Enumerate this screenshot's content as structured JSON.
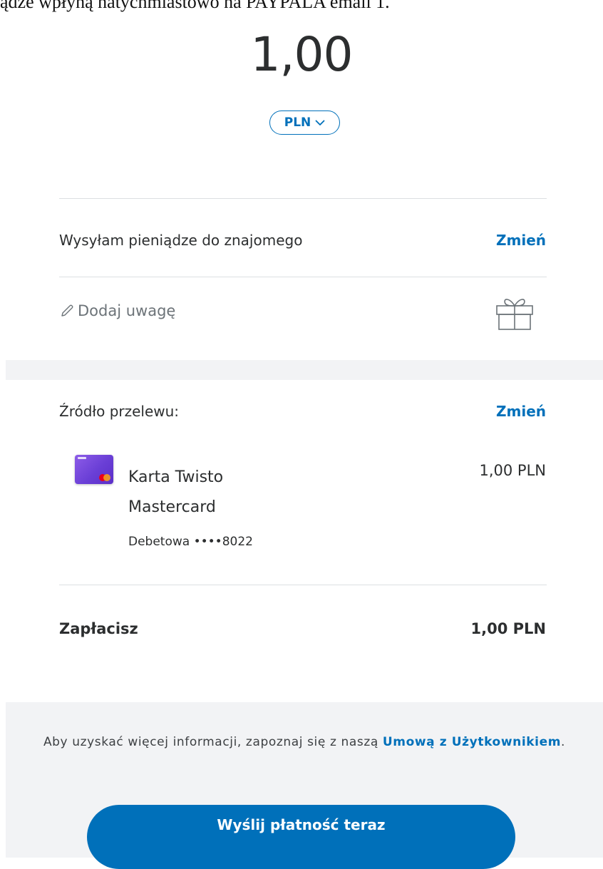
{
  "banner": {
    "text": "ądze wpłyną natychmiastowo na PAYPALA email 1."
  },
  "amount": {
    "value": "1,00",
    "currency_label": "PLN"
  },
  "purpose": {
    "label": "Wysyłam pieniądze do znajomego",
    "change_label": "Zmień"
  },
  "note": {
    "placeholder": "Dodaj uwagę",
    "pencil_icon": "pencil-icon",
    "gift_icon": "gift-icon"
  },
  "funding": {
    "label": "Źródło przelewu:",
    "change_label": "Zmień",
    "card_name_line1": "Karta Twisto",
    "card_name_line2": "Mastercard",
    "card_detail": "Debetowa ••••8022",
    "card_amount": "1,00 PLN"
  },
  "total": {
    "label": "Zapłacisz",
    "amount": "1,00 PLN"
  },
  "footer": {
    "text_before": "Aby uzyskać więcej informacji, zapoznaj się z naszą ",
    "link_label": "Umową z Użytkownikiem",
    "text_after": "."
  },
  "actions": {
    "send_label": "Wyślij płatność teraz"
  },
  "colors": {
    "accent": "#0070ba",
    "band": "#f2f3f5",
    "divider": "#dcdfe2",
    "text": "#2c2e2f"
  }
}
